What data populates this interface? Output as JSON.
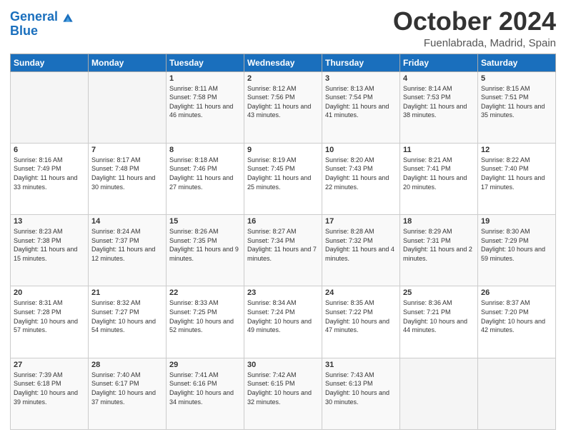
{
  "header": {
    "logo_line1": "General",
    "logo_line2": "Blue",
    "month": "October 2024",
    "location": "Fuenlabrada, Madrid, Spain"
  },
  "weekdays": [
    "Sunday",
    "Monday",
    "Tuesday",
    "Wednesday",
    "Thursday",
    "Friday",
    "Saturday"
  ],
  "weeks": [
    [
      {
        "day": "",
        "empty": true
      },
      {
        "day": "",
        "empty": true
      },
      {
        "day": "1",
        "sunrise": "8:11 AM",
        "sunset": "7:58 PM",
        "daylight": "11 hours and 46 minutes."
      },
      {
        "day": "2",
        "sunrise": "8:12 AM",
        "sunset": "7:56 PM",
        "daylight": "11 hours and 43 minutes."
      },
      {
        "day": "3",
        "sunrise": "8:13 AM",
        "sunset": "7:54 PM",
        "daylight": "11 hours and 41 minutes."
      },
      {
        "day": "4",
        "sunrise": "8:14 AM",
        "sunset": "7:53 PM",
        "daylight": "11 hours and 38 minutes."
      },
      {
        "day": "5",
        "sunrise": "8:15 AM",
        "sunset": "7:51 PM",
        "daylight": "11 hours and 35 minutes."
      }
    ],
    [
      {
        "day": "6",
        "sunrise": "8:16 AM",
        "sunset": "7:49 PM",
        "daylight": "11 hours and 33 minutes."
      },
      {
        "day": "7",
        "sunrise": "8:17 AM",
        "sunset": "7:48 PM",
        "daylight": "11 hours and 30 minutes."
      },
      {
        "day": "8",
        "sunrise": "8:18 AM",
        "sunset": "7:46 PM",
        "daylight": "11 hours and 27 minutes."
      },
      {
        "day": "9",
        "sunrise": "8:19 AM",
        "sunset": "7:45 PM",
        "daylight": "11 hours and 25 minutes."
      },
      {
        "day": "10",
        "sunrise": "8:20 AM",
        "sunset": "7:43 PM",
        "daylight": "11 hours and 22 minutes."
      },
      {
        "day": "11",
        "sunrise": "8:21 AM",
        "sunset": "7:41 PM",
        "daylight": "11 hours and 20 minutes."
      },
      {
        "day": "12",
        "sunrise": "8:22 AM",
        "sunset": "7:40 PM",
        "daylight": "11 hours and 17 minutes."
      }
    ],
    [
      {
        "day": "13",
        "sunrise": "8:23 AM",
        "sunset": "7:38 PM",
        "daylight": "11 hours and 15 minutes."
      },
      {
        "day": "14",
        "sunrise": "8:24 AM",
        "sunset": "7:37 PM",
        "daylight": "11 hours and 12 minutes."
      },
      {
        "day": "15",
        "sunrise": "8:26 AM",
        "sunset": "7:35 PM",
        "daylight": "11 hours and 9 minutes."
      },
      {
        "day": "16",
        "sunrise": "8:27 AM",
        "sunset": "7:34 PM",
        "daylight": "11 hours and 7 minutes."
      },
      {
        "day": "17",
        "sunrise": "8:28 AM",
        "sunset": "7:32 PM",
        "daylight": "11 hours and 4 minutes."
      },
      {
        "day": "18",
        "sunrise": "8:29 AM",
        "sunset": "7:31 PM",
        "daylight": "11 hours and 2 minutes."
      },
      {
        "day": "19",
        "sunrise": "8:30 AM",
        "sunset": "7:29 PM",
        "daylight": "10 hours and 59 minutes."
      }
    ],
    [
      {
        "day": "20",
        "sunrise": "8:31 AM",
        "sunset": "7:28 PM",
        "daylight": "10 hours and 57 minutes."
      },
      {
        "day": "21",
        "sunrise": "8:32 AM",
        "sunset": "7:27 PM",
        "daylight": "10 hours and 54 minutes."
      },
      {
        "day": "22",
        "sunrise": "8:33 AM",
        "sunset": "7:25 PM",
        "daylight": "10 hours and 52 minutes."
      },
      {
        "day": "23",
        "sunrise": "8:34 AM",
        "sunset": "7:24 PM",
        "daylight": "10 hours and 49 minutes."
      },
      {
        "day": "24",
        "sunrise": "8:35 AM",
        "sunset": "7:22 PM",
        "daylight": "10 hours and 47 minutes."
      },
      {
        "day": "25",
        "sunrise": "8:36 AM",
        "sunset": "7:21 PM",
        "daylight": "10 hours and 44 minutes."
      },
      {
        "day": "26",
        "sunrise": "8:37 AM",
        "sunset": "7:20 PM",
        "daylight": "10 hours and 42 minutes."
      }
    ],
    [
      {
        "day": "27",
        "sunrise": "7:39 AM",
        "sunset": "6:18 PM",
        "daylight": "10 hours and 39 minutes."
      },
      {
        "day": "28",
        "sunrise": "7:40 AM",
        "sunset": "6:17 PM",
        "daylight": "10 hours and 37 minutes."
      },
      {
        "day": "29",
        "sunrise": "7:41 AM",
        "sunset": "6:16 PM",
        "daylight": "10 hours and 34 minutes."
      },
      {
        "day": "30",
        "sunrise": "7:42 AM",
        "sunset": "6:15 PM",
        "daylight": "10 hours and 32 minutes."
      },
      {
        "day": "31",
        "sunrise": "7:43 AM",
        "sunset": "6:13 PM",
        "daylight": "10 hours and 30 minutes."
      },
      {
        "day": "",
        "empty": true
      },
      {
        "day": "",
        "empty": true
      }
    ]
  ]
}
